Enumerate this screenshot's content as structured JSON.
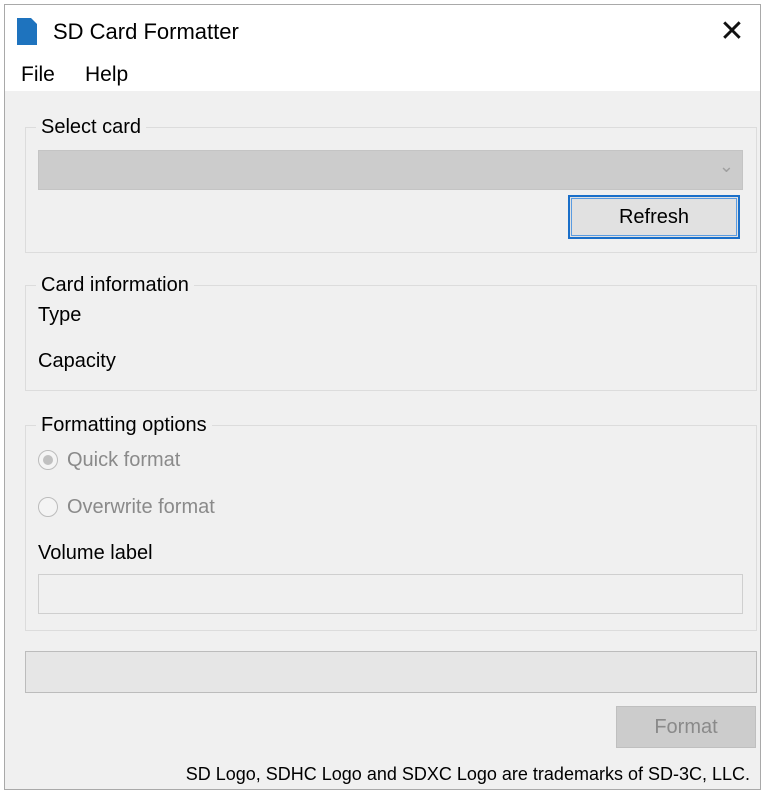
{
  "window": {
    "title": "SD Card Formatter",
    "close_glyph": "✕"
  },
  "menu": {
    "file": "File",
    "help": "Help"
  },
  "select_card": {
    "legend": "Select card",
    "selected_value": "",
    "refresh_label": "Refresh"
  },
  "card_information": {
    "legend": "Card information",
    "type_label": "Type",
    "capacity_label": "Capacity"
  },
  "formatting_options": {
    "legend": "Formatting options",
    "quick_format": "Quick format",
    "overwrite_format": "Overwrite format",
    "volume_label": "Volume label",
    "volume_value": ""
  },
  "progress": {
    "value": 0
  },
  "actions": {
    "format_label": "Format"
  },
  "footer": {
    "trademark": "SD Logo, SDHC Logo and SDXC Logo are trademarks of SD-3C, LLC."
  },
  "icons": {
    "app": "sd-card-icon",
    "close": "close-icon",
    "dropdown": "chevron-down-icon"
  },
  "colors": {
    "accent": "#1a6fc9",
    "app_icon": "#1e73be"
  }
}
